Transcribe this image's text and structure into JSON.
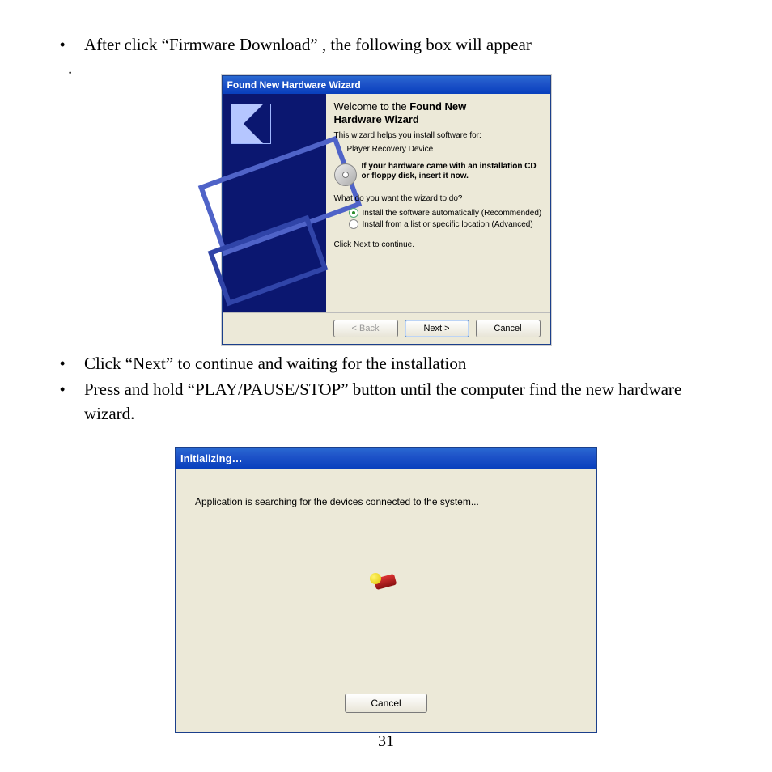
{
  "doc": {
    "bullet1": "After click “Firmware Download” , the following box will appear",
    "dot": ".",
    "bullet2": "Click “Next” to continue and waiting for the installation",
    "bullet3": "Press and hold “PLAY/PAUSE/STOP” button until the computer find the new hardware",
    "bullet3b": "wizard.",
    "page_number": "31"
  },
  "wizard": {
    "title": "Found New Hardware Wizard",
    "heading_a": "Welcome to the ",
    "heading_b": "Found New",
    "heading_c": "Hardware Wizard",
    "helps": "This wizard helps you install software for:",
    "device": "Player Recovery Device",
    "cd_line1": "If your hardware came with an installation CD",
    "cd_line2": "or floppy disk, insert it now.",
    "question": "What do you want the wizard to do?",
    "opt1": "Install the software automatically (Recommended)",
    "opt2": "Install from a list or specific location (Advanced)",
    "next_hint": "Click Next to continue.",
    "back": "< Back",
    "next": "Next >",
    "cancel": "Cancel"
  },
  "init": {
    "title": "Initializing…",
    "msg": "Application is searching for the devices connected to the system...",
    "cancel": "Cancel"
  }
}
